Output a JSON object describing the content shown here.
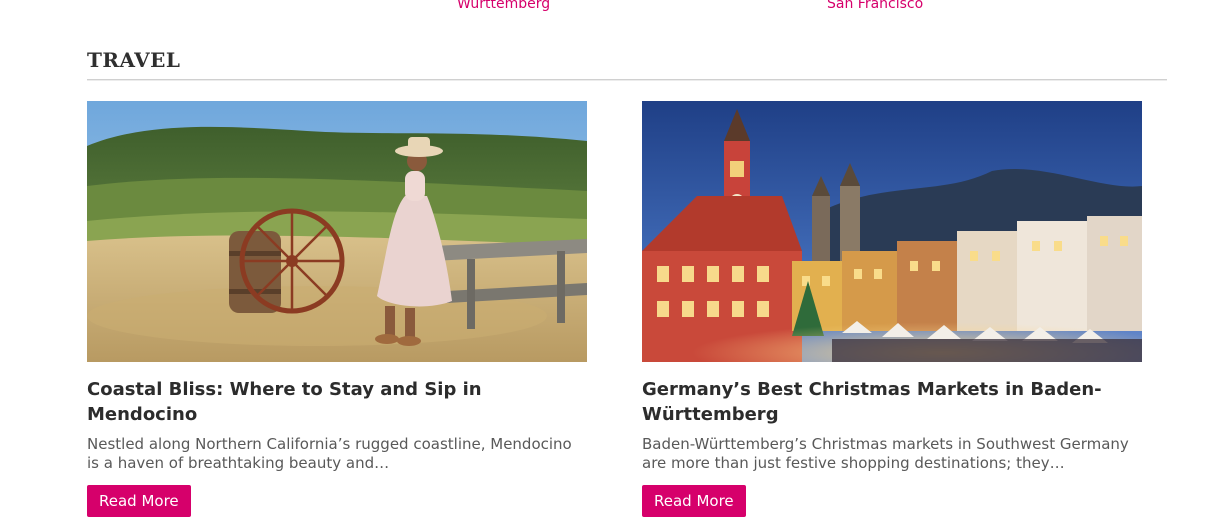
{
  "prev_row": {
    "link_1": "Württemberg",
    "link_2": "San Francisco"
  },
  "section": {
    "title": "TRAVEL"
  },
  "cards": [
    {
      "title": "Coastal Bliss: Where to Stay and Sip in Mendocino",
      "excerpt": "Nestled along Northern California’s rugged coastline, Mendocino is a haven of breathtaking beauty and…",
      "button": "Read More",
      "image_icon": "mendocino-photo"
    },
    {
      "title": "Germany’s Best Christmas Markets in Baden-Württemberg",
      "excerpt": "Baden-Württemberg’s Christmas markets in Southwest Germany are more than just festive shopping destinations; they…",
      "button": "Read More",
      "image_icon": "christmas-market-photo"
    }
  ],
  "colors": {
    "accent": "#d6006b",
    "title_text": "#2c2c2c",
    "body_text": "#595959",
    "rule": "#d0d0d0"
  }
}
